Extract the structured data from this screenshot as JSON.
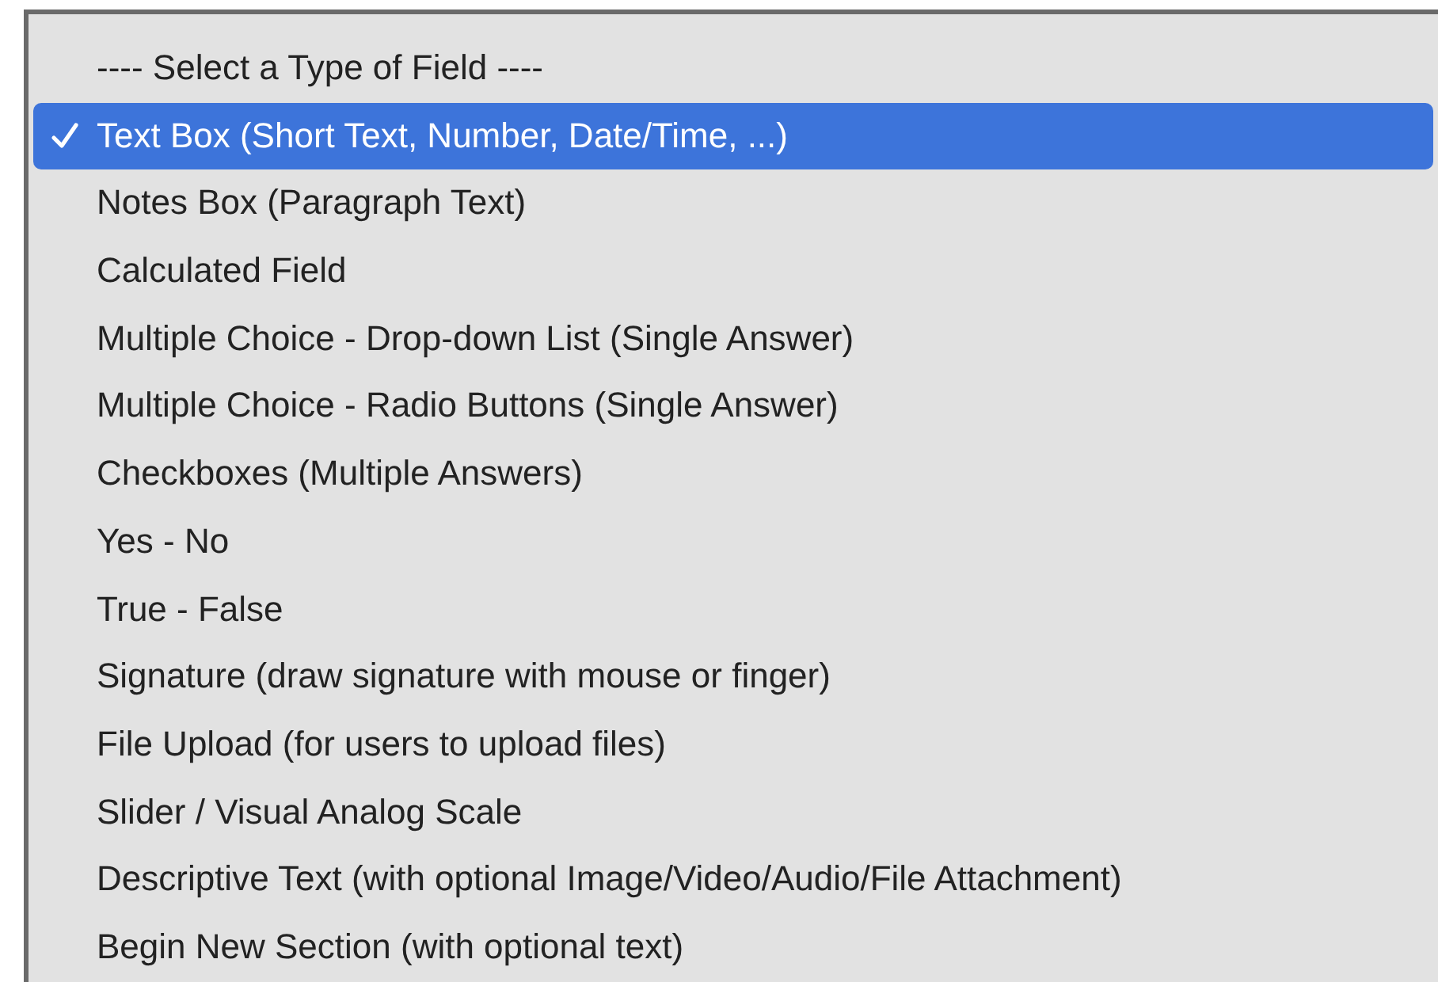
{
  "menu": {
    "items": [
      {
        "label": "---- Select a Type of Field ----",
        "selected": false
      },
      {
        "label": "Text Box (Short Text, Number, Date/Time, ...)",
        "selected": true
      },
      {
        "label": "Notes Box (Paragraph Text)",
        "selected": false
      },
      {
        "label": "Calculated Field",
        "selected": false
      },
      {
        "label": "Multiple Choice - Drop-down List (Single Answer)",
        "selected": false
      },
      {
        "label": "Multiple Choice - Radio Buttons (Single Answer)",
        "selected": false
      },
      {
        "label": "Checkboxes (Multiple Answers)",
        "selected": false
      },
      {
        "label": "Yes - No",
        "selected": false
      },
      {
        "label": "True - False",
        "selected": false
      },
      {
        "label": "Signature (draw signature with mouse or finger)",
        "selected": false
      },
      {
        "label": "File Upload (for users to upload files)",
        "selected": false
      },
      {
        "label": "Slider / Visual Analog Scale",
        "selected": false
      },
      {
        "label": "Descriptive Text (with optional Image/Video/Audio/File Attachment)",
        "selected": false
      },
      {
        "label": "Begin New Section (with optional text)",
        "selected": false
      }
    ]
  }
}
